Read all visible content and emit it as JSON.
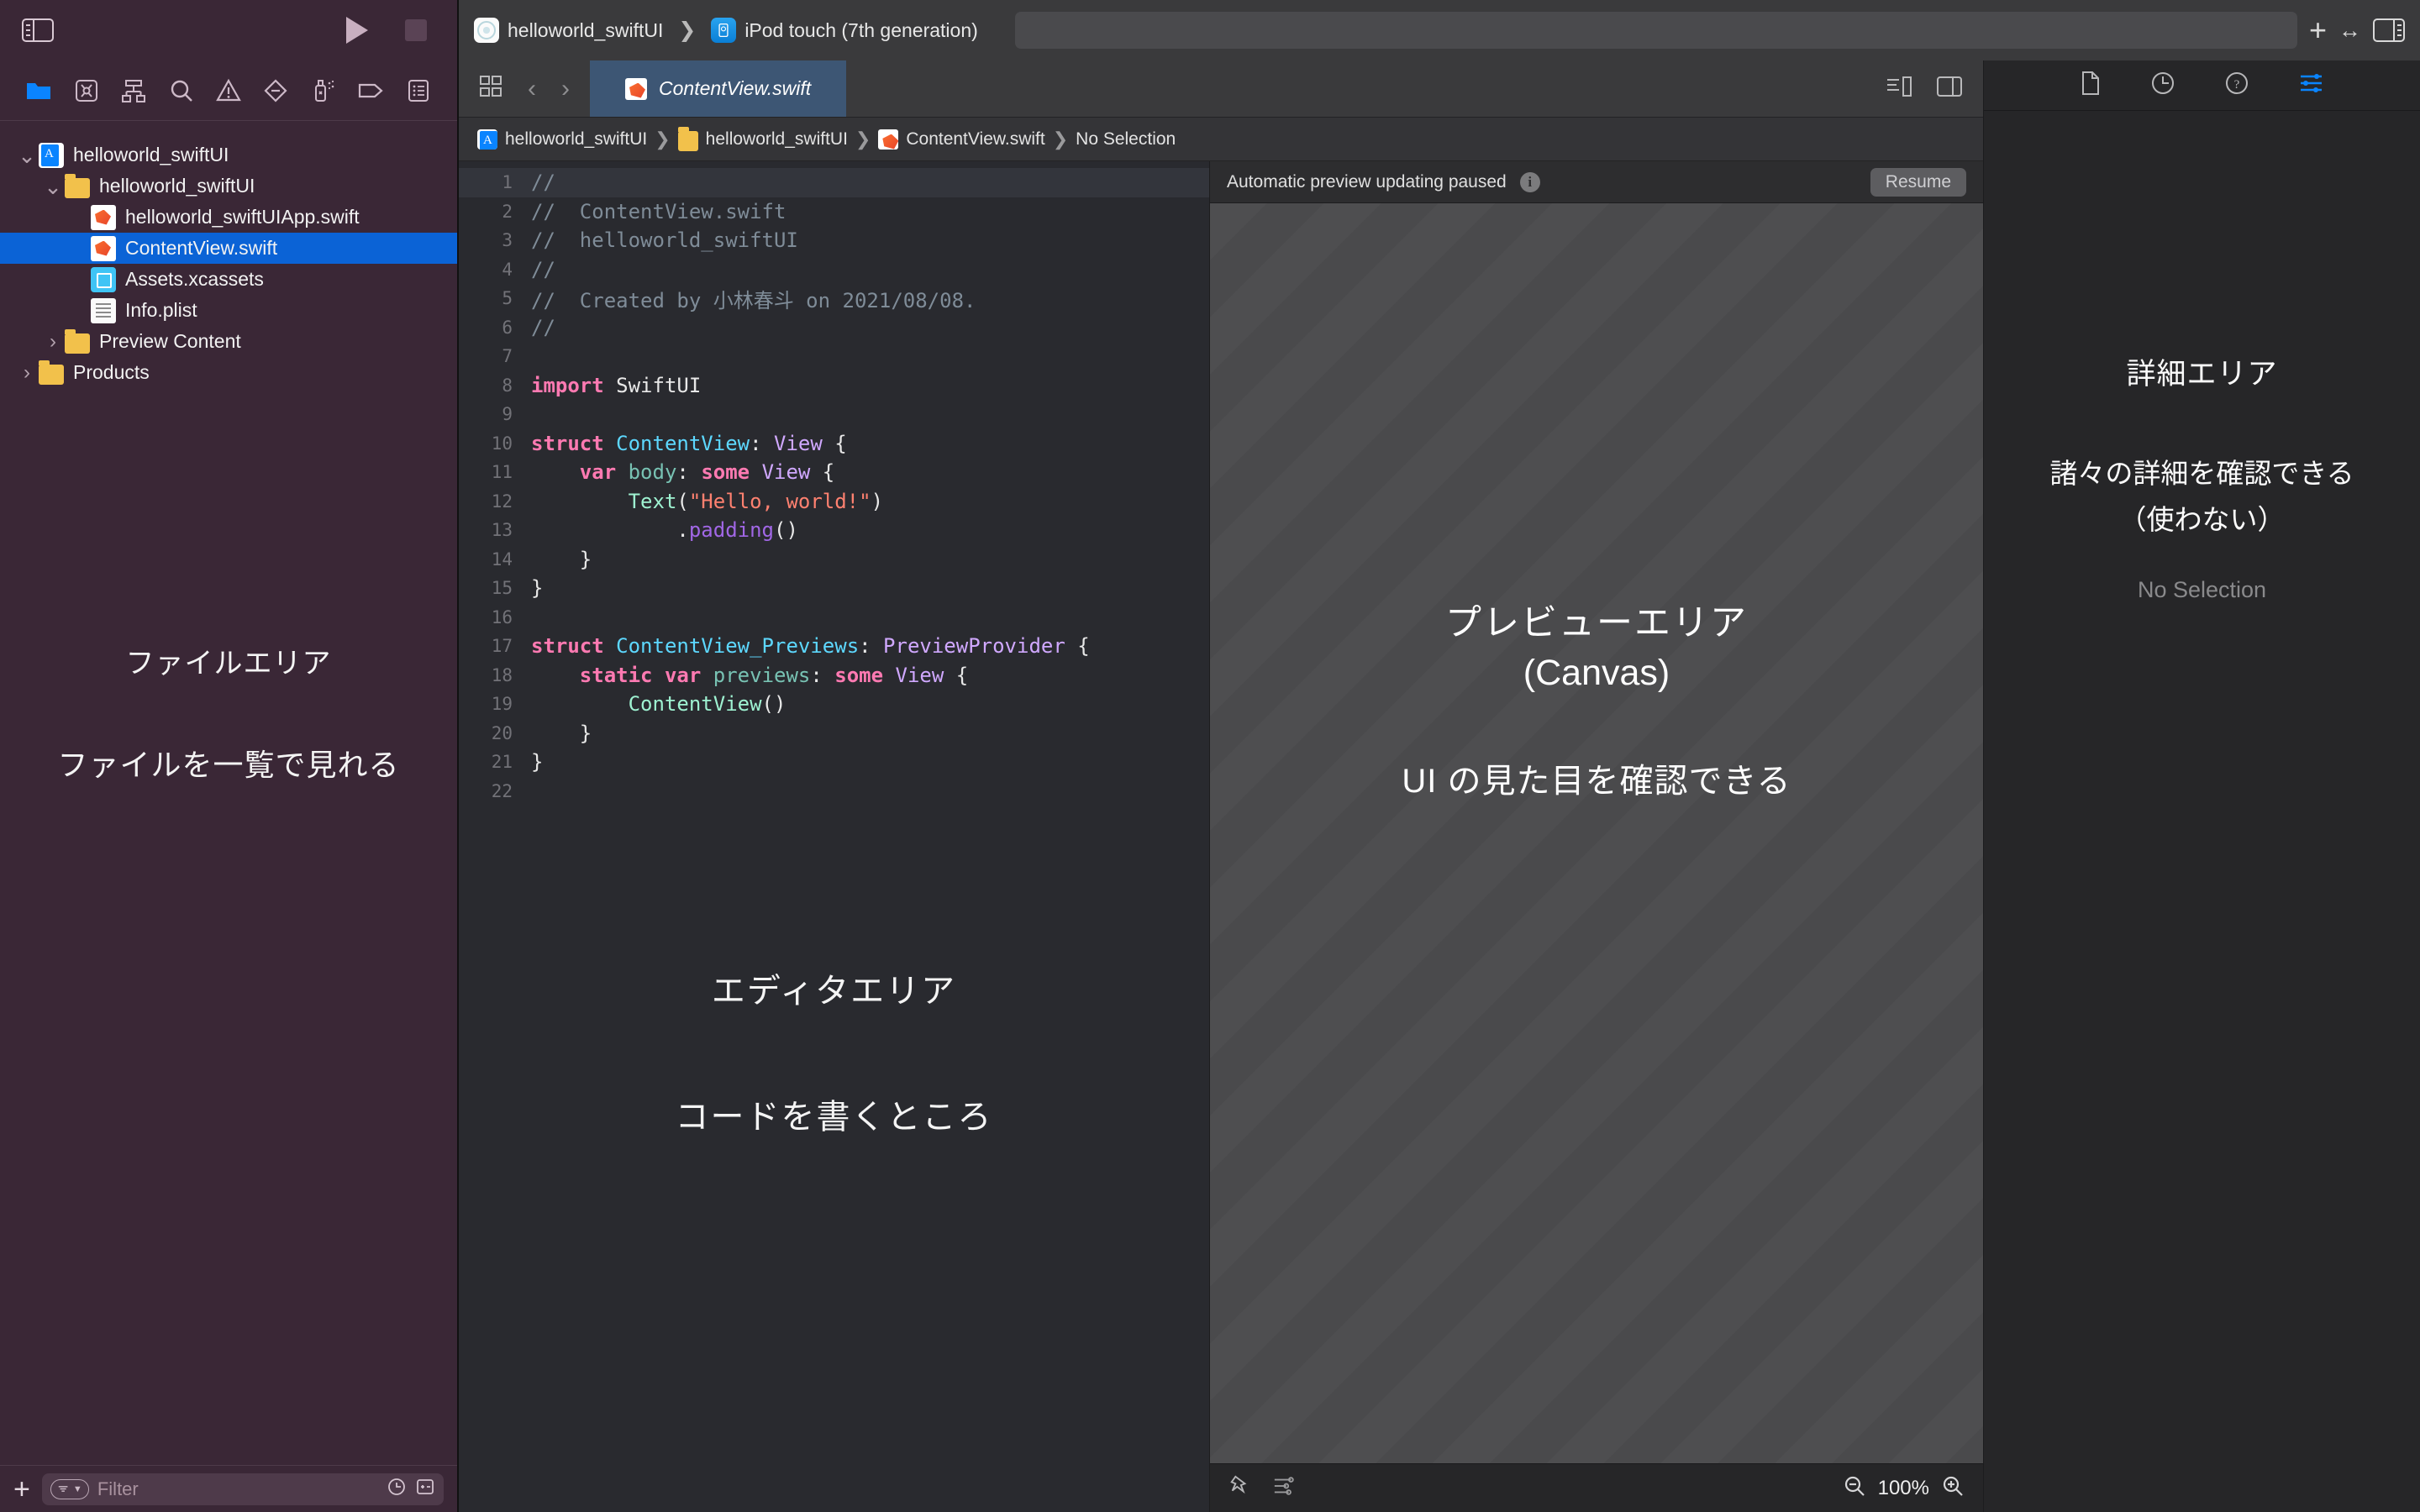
{
  "toolbar": {
    "scheme_project": "helloworld_swiftUI",
    "scheme_device": "iPod touch (7th generation)",
    "project_icon": "app-icon",
    "device_icon": "simulator-icon",
    "run_button": "run-button",
    "stop_button": "stop-button",
    "add_button": "+",
    "history_arrows": "↔",
    "left_panel_toggle": "left-panel-toggle",
    "right_panel_toggle": "right-panel-toggle"
  },
  "navigator": {
    "icon_tabs": [
      {
        "name": "folder-icon",
        "active": true
      },
      {
        "name": "source-control-icon",
        "active": false
      },
      {
        "name": "symbol-hierarchy-icon",
        "active": false
      },
      {
        "name": "search-icon",
        "active": false
      },
      {
        "name": "warning-triangle-icon",
        "active": false
      },
      {
        "name": "test-diamond-icon",
        "active": false
      },
      {
        "name": "debug-spray-icon",
        "active": false
      },
      {
        "name": "breakpoint-tag-icon",
        "active": false
      },
      {
        "name": "report-list-icon",
        "active": false
      }
    ],
    "tree": [
      {
        "label": "helloworld_swiftUI",
        "icon": "project-icon",
        "indent": 0,
        "twisty": "down",
        "selected": false
      },
      {
        "label": "helloworld_swiftUI",
        "icon": "folder-icon",
        "indent": 1,
        "twisty": "down",
        "selected": false
      },
      {
        "label": "helloworld_swiftUIApp.swift",
        "icon": "swift-file-icon",
        "indent": 2,
        "twisty": "none",
        "selected": false
      },
      {
        "label": "ContentView.swift",
        "icon": "swift-file-icon",
        "indent": 2,
        "twisty": "none",
        "selected": true
      },
      {
        "label": "Assets.xcassets",
        "icon": "assets-icon",
        "indent": 2,
        "twisty": "none",
        "selected": false
      },
      {
        "label": "Info.plist",
        "icon": "plist-icon",
        "indent": 2,
        "twisty": "none",
        "selected": false
      },
      {
        "label": "Preview Content",
        "icon": "folder-icon",
        "indent": 1,
        "twisty": "right",
        "selected": false
      },
      {
        "label": "Products",
        "icon": "folder-icon",
        "indent": 0,
        "twisty": "right",
        "selected": false
      }
    ],
    "annotation_title": "ファイルエリア",
    "annotation_desc": "ファイルを一覧で見れる",
    "filter": {
      "add_label": "+",
      "placeholder": "Filter",
      "recent_icon": "clock-icon",
      "modified_icon": "source-control-filter-icon"
    }
  },
  "editor": {
    "tab_label": "ContentView.swift",
    "tab_icon": "swift-file-icon",
    "grid_icon": "editor-layout-icon",
    "back_arrow": "‹",
    "forward_arrow": "›",
    "right_icons": [
      "minimap-icon",
      "split-editor-icon"
    ],
    "breadcrumb": [
      {
        "label": "helloworld_swiftUI",
        "icon": "project-icon"
      },
      {
        "label": "helloworld_swiftUI",
        "icon": "folder-icon"
      },
      {
        "label": "ContentView.swift",
        "icon": "swift-file-icon"
      },
      {
        "label": "No Selection",
        "icon": "none"
      }
    ],
    "annotation_title": "エディタエリア",
    "annotation_desc": "コードを書くところ",
    "code_lines": [
      {
        "n": 1,
        "tokens": [
          {
            "t": "//",
            "c": "cmt"
          }
        ]
      },
      {
        "n": 2,
        "tokens": [
          {
            "t": "//  ContentView.swift",
            "c": "cmt"
          }
        ]
      },
      {
        "n": 3,
        "tokens": [
          {
            "t": "//  helloworld_swiftUI",
            "c": "cmt"
          }
        ]
      },
      {
        "n": 4,
        "tokens": [
          {
            "t": "//",
            "c": "cmt"
          }
        ]
      },
      {
        "n": 5,
        "tokens": [
          {
            "t": "//  Created by 小林春斗 on 2021/08/08.",
            "c": "cmt"
          }
        ]
      },
      {
        "n": 6,
        "tokens": [
          {
            "t": "//",
            "c": "cmt"
          }
        ]
      },
      {
        "n": 7,
        "tokens": []
      },
      {
        "n": 8,
        "tokens": [
          {
            "t": "import",
            "c": "kw"
          },
          {
            "t": " SwiftUI",
            "c": "plain"
          }
        ]
      },
      {
        "n": 9,
        "tokens": []
      },
      {
        "n": 10,
        "tokens": [
          {
            "t": "struct",
            "c": "kw"
          },
          {
            "t": " ",
            "c": "plain"
          },
          {
            "t": "ContentView",
            "c": "typ"
          },
          {
            "t": ": ",
            "c": "plain"
          },
          {
            "t": "View",
            "c": "typ2"
          },
          {
            "t": " {",
            "c": "plain"
          }
        ]
      },
      {
        "n": 11,
        "tokens": [
          {
            "t": "    ",
            "c": "plain"
          },
          {
            "t": "var",
            "c": "kw"
          },
          {
            "t": " ",
            "c": "plain"
          },
          {
            "t": "body",
            "c": "prop"
          },
          {
            "t": ": ",
            "c": "plain"
          },
          {
            "t": "some",
            "c": "kw"
          },
          {
            "t": " ",
            "c": "plain"
          },
          {
            "t": "View",
            "c": "typ2"
          },
          {
            "t": " {",
            "c": "plain"
          }
        ]
      },
      {
        "n": 12,
        "tokens": [
          {
            "t": "        ",
            "c": "plain"
          },
          {
            "t": "Text",
            "c": "ident"
          },
          {
            "t": "(",
            "c": "plain"
          },
          {
            "t": "\"Hello, world!\"",
            "c": "str"
          },
          {
            "t": ")",
            "c": "plain"
          }
        ]
      },
      {
        "n": 13,
        "tokens": [
          {
            "t": "            .",
            "c": "plain"
          },
          {
            "t": "padding",
            "c": "fn"
          },
          {
            "t": "()",
            "c": "plain"
          }
        ]
      },
      {
        "n": 14,
        "tokens": [
          {
            "t": "    }",
            "c": "plain"
          }
        ]
      },
      {
        "n": 15,
        "tokens": [
          {
            "t": "}",
            "c": "plain"
          }
        ]
      },
      {
        "n": 16,
        "tokens": []
      },
      {
        "n": 17,
        "tokens": [
          {
            "t": "struct",
            "c": "kw"
          },
          {
            "t": " ",
            "c": "plain"
          },
          {
            "t": "ContentView_Previews",
            "c": "typ"
          },
          {
            "t": ": ",
            "c": "plain"
          },
          {
            "t": "PreviewProvider",
            "c": "typ2"
          },
          {
            "t": " {",
            "c": "plain"
          }
        ]
      },
      {
        "n": 18,
        "tokens": [
          {
            "t": "    ",
            "c": "plain"
          },
          {
            "t": "static",
            "c": "kw"
          },
          {
            "t": " ",
            "c": "plain"
          },
          {
            "t": "var",
            "c": "kw"
          },
          {
            "t": " ",
            "c": "plain"
          },
          {
            "t": "previews",
            "c": "prop"
          },
          {
            "t": ": ",
            "c": "plain"
          },
          {
            "t": "some",
            "c": "kw"
          },
          {
            "t": " ",
            "c": "plain"
          },
          {
            "t": "View",
            "c": "typ2"
          },
          {
            "t": " {",
            "c": "plain"
          }
        ]
      },
      {
        "n": 19,
        "tokens": [
          {
            "t": "        ",
            "c": "plain"
          },
          {
            "t": "ContentView",
            "c": "ident"
          },
          {
            "t": "()",
            "c": "plain"
          }
        ]
      },
      {
        "n": 20,
        "tokens": [
          {
            "t": "    }",
            "c": "plain"
          }
        ]
      },
      {
        "n": 21,
        "tokens": [
          {
            "t": "}",
            "c": "plain"
          }
        ]
      },
      {
        "n": 22,
        "tokens": []
      }
    ]
  },
  "preview": {
    "status_text": "Automatic preview updating paused",
    "info_icon": "info-icon",
    "resume_label": "Resume",
    "annotation_title_1": "プレビューエリア",
    "annotation_title_2": "(Canvas)",
    "annotation_desc": "UI の見た目を確認できる",
    "footer": {
      "pin_icon": "pin-icon",
      "settings_icon": "preview-settings-icon",
      "zoom_out_icon": "zoom-out-icon",
      "zoom_level": "100%",
      "zoom_in_icon": "zoom-in-icon"
    }
  },
  "inspector": {
    "tabs": [
      {
        "name": "file-inspector-icon",
        "active": false
      },
      {
        "name": "history-inspector-icon",
        "active": false
      },
      {
        "name": "quick-help-icon",
        "active": false
      },
      {
        "name": "attributes-inspector-icon",
        "active": true
      }
    ],
    "annotation_title": "詳細エリア",
    "annotation_desc_1": "諸々の詳細を確認できる",
    "annotation_desc_2": "（使わない）",
    "no_selection": "No Selection"
  },
  "colors": {
    "navigator_bg": "#3a2736",
    "toolbar_bg": "#3a3a3c",
    "editor_bg": "#292a2f",
    "selection_blue": "#0b63d6",
    "tab_active_bg": "#3d5674",
    "canvas_bg": "#4a4a4c",
    "accent_blue": "#0a84ff"
  }
}
